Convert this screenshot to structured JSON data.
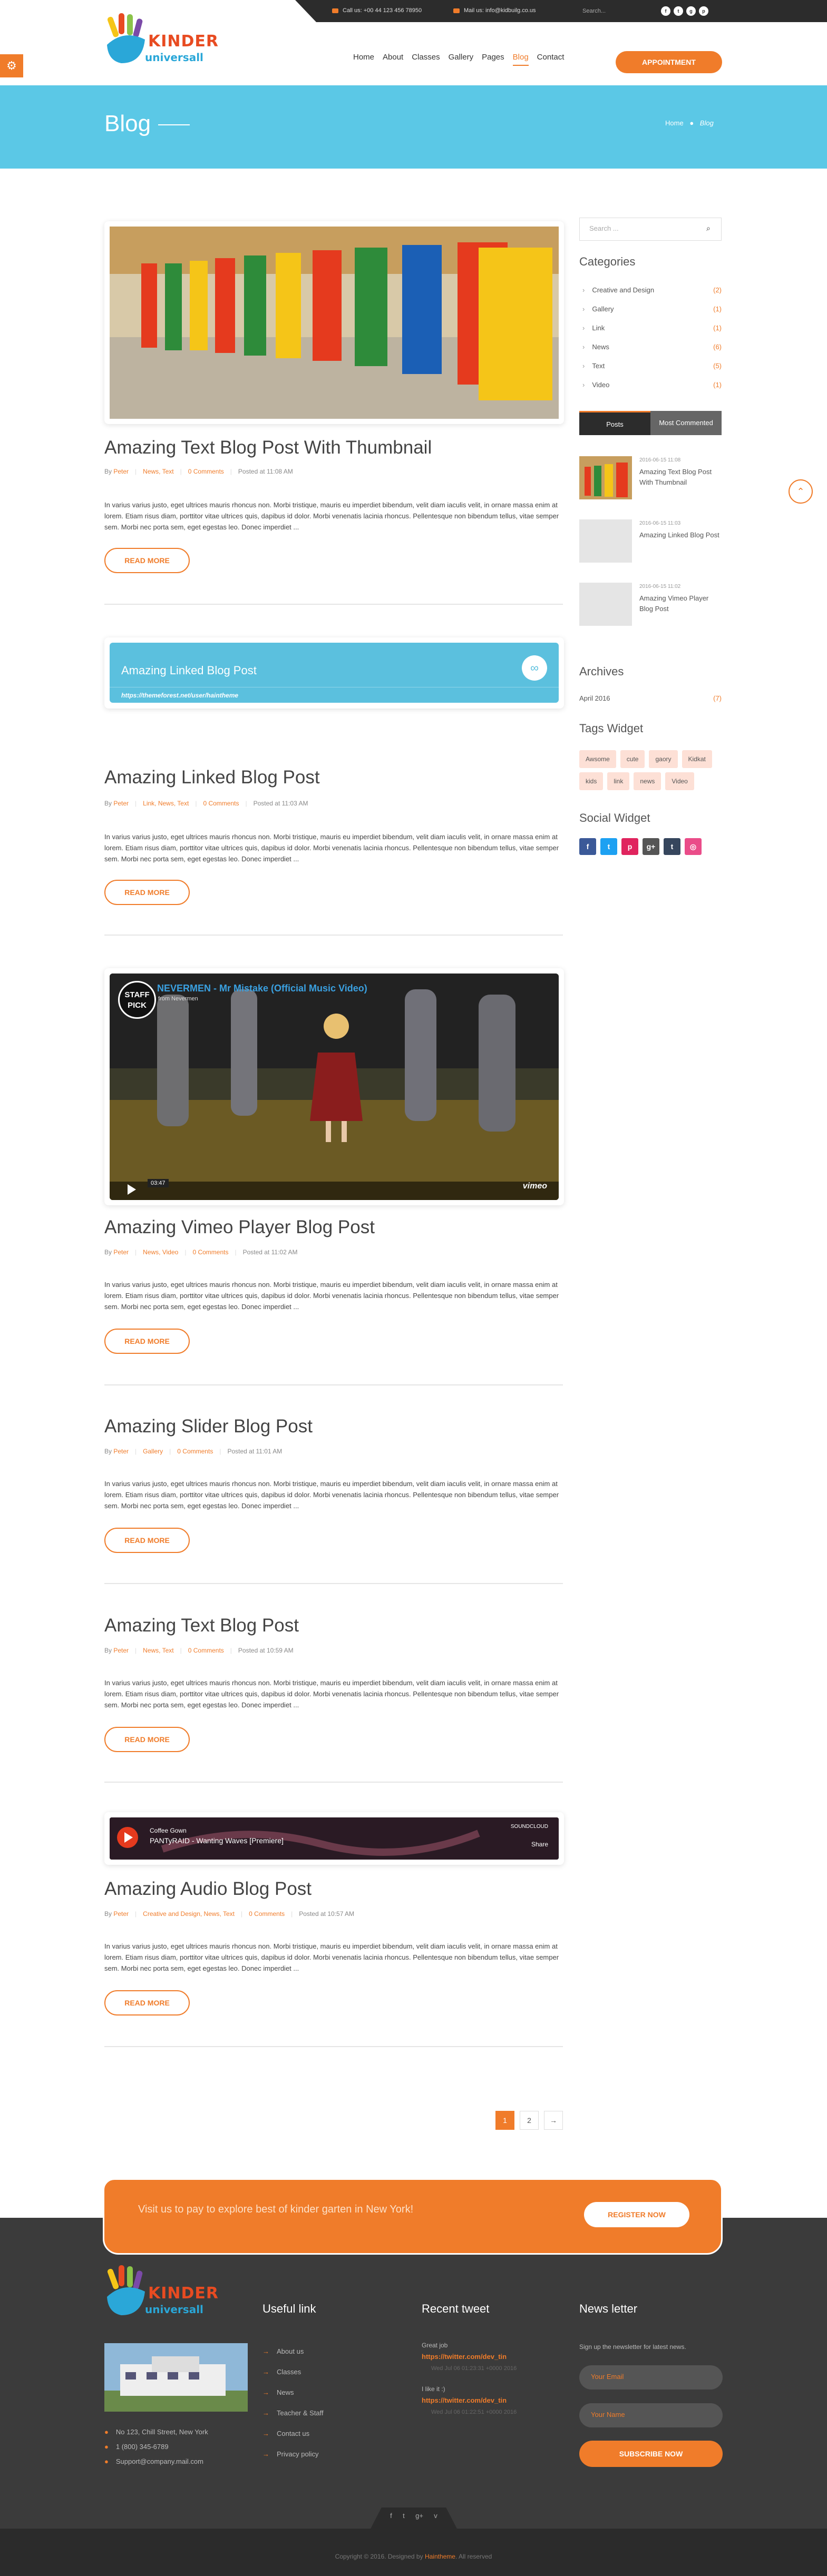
{
  "topbar": {
    "call": "Call us: +00 44 123 456 78950",
    "mail": "Mail us: info@kidbuilg.co.us",
    "search_placeholder": "Search...",
    "social": [
      "f",
      "t",
      "g",
      "p"
    ]
  },
  "logo": {
    "line1": "KINDER",
    "line2": "universall"
  },
  "nav": {
    "items": [
      "Home",
      "About",
      "Classes",
      "Gallery",
      "Pages",
      "Blog",
      "Contact"
    ],
    "appointment": "APPOINTMENT",
    "gear": "⚙"
  },
  "banner": {
    "title": "Blog",
    "breadcrumb_home": "Home",
    "breadcrumb_current": "Blog"
  },
  "posts": [
    {
      "title": "Amazing Text Blog Post With Thumbnail",
      "author": "Peter",
      "cats": "News, Text",
      "comments": "0 Comments",
      "posted": "Posted at 11:08 AM",
      "excerpt": "In varius varius justo, eget ultrices mauris rhoncus non. Morbi tristique, mauris eu imperdiet bibendum, velit diam iaculis velit, in ornare massa enim at lorem. Etiam risus diam, porttitor vitae ultrices quis, dapibus id dolor. Morbi venenatis lacinia rhoncus. Pellentesque non bibendum tellus, vitae semper sem. Morbi nec porta sem, eget egestas leo. Donec imperdiet ...",
      "read": "READ MORE"
    },
    {
      "title": "Amazing Linked Blog Post",
      "author": "Peter",
      "cats": "Link, News, Text",
      "comments": "0 Comments",
      "posted": "Posted at 11:03 AM",
      "excerpt": "In varius varius justo, eget ultrices mauris rhoncus non. Morbi tristique, mauris eu imperdiet bibendum, velit diam iaculis velit, in ornare massa enim at lorem. Etiam risus diam, porttitor vitae ultrices quis, dapibus id dolor. Morbi venenatis lacinia rhoncus. Pellentesque non bibendum tellus, vitae semper sem. Morbi nec porta sem, eget egestas leo. Donec imperdiet ...",
      "read": "READ MORE"
    },
    {
      "title": "Amazing Vimeo Player Blog Post",
      "author": "Peter",
      "cats": "News, Video",
      "comments": "0 Comments",
      "posted": "Posted at 11:02 AM",
      "excerpt": "In varius varius justo, eget ultrices mauris rhoncus non. Morbi tristique, mauris eu imperdiet bibendum, velit diam iaculis velit, in ornare massa enim at lorem. Etiam risus diam, porttitor vitae ultrices quis, dapibus id dolor. Morbi venenatis lacinia rhoncus. Pellentesque non bibendum tellus, vitae semper sem. Morbi nec porta sem, eget egestas leo. Donec imperdiet ...",
      "read": "READ MORE"
    },
    {
      "title": "Amazing Slider Blog Post",
      "author": "Peter",
      "cats": "Gallery",
      "comments": "0 Comments",
      "posted": "Posted at 11:01 AM",
      "excerpt": "In varius varius justo, eget ultrices mauris rhoncus non. Morbi tristique, mauris eu imperdiet bibendum, velit diam iaculis velit, in ornare massa enim at lorem. Etiam risus diam, porttitor vitae ultrices quis, dapibus id dolor. Morbi venenatis lacinia rhoncus. Pellentesque non bibendum tellus, vitae semper sem. Morbi nec porta sem, eget egestas leo. Donec imperdiet ...",
      "read": "READ MORE"
    },
    {
      "title": "Amazing Text Blog Post",
      "author": "Peter",
      "cats": "News, Text",
      "comments": "0 Comments",
      "posted": "Posted at 10:59 AM",
      "excerpt": "In varius varius justo, eget ultrices mauris rhoncus non. Morbi tristique, mauris eu imperdiet bibendum, velit diam iaculis velit, in ornare massa enim at lorem. Etiam risus diam, porttitor vitae ultrices quis, dapibus id dolor. Morbi venenatis lacinia rhoncus. Pellentesque non bibendum tellus, vitae semper sem. Morbi nec porta sem, eget egestas leo. Donec imperdiet ...",
      "read": "READ MORE"
    },
    {
      "title": "Amazing Audio Blog Post",
      "author": "Peter",
      "cats": "Creative and Design, News, Text",
      "comments": "0 Comments",
      "posted": "Posted at 10:57 AM",
      "excerpt": "In varius varius justo, eget ultrices mauris rhoncus non. Morbi tristique, mauris eu imperdiet bibendum, velit diam iaculis velit, in ornare massa enim at lorem. Etiam risus diam, porttitor vitae ultrices quis, dapibus id dolor. Morbi venenatis lacinia rhoncus. Pellentesque non bibendum tellus, vitae semper sem. Morbi nec porta sem, eget egestas leo. Donec imperdiet ...",
      "read": "READ MORE"
    }
  ],
  "linked": {
    "title": "Amazing Linked Blog Post",
    "url": "https://themeforest.net/user/haintheme"
  },
  "video": {
    "title": "NEVERMEN - Mr Mistake (Official Music Video)",
    "by": "from Nevermen",
    "badge": "STAFF PICK",
    "time": "03:47",
    "brand": "vimeo"
  },
  "audio": {
    "label": "SOUNDCLOUD",
    "artist": "Coffee Gown",
    "track": "PANTyRAID - Wanting Waves [Premiere]",
    "share": "Share"
  },
  "sidebar": {
    "search_placeholder": "Search ...",
    "categories_title": "Categories",
    "categories": [
      {
        "name": "Creative and Design",
        "count": "(2)"
      },
      {
        "name": "Gallery",
        "count": "(1)"
      },
      {
        "name": "Link",
        "count": "(1)"
      },
      {
        "name": "News",
        "count": "(6)"
      },
      {
        "name": "Text",
        "count": "(5)"
      },
      {
        "name": "Video",
        "count": "(1)"
      }
    ],
    "tab_posts": "Posts",
    "tab_commented": "Most Commented",
    "recent": [
      {
        "date": "2016-06-15 11:08",
        "title": "Amazing Text Blog Post With Thumbnail"
      },
      {
        "date": "2016-06-15 11:03",
        "title": "Amazing Linked Blog Post"
      },
      {
        "date": "2016-06-15 11:02",
        "title": "Amazing Vimeo Player Blog Post"
      }
    ],
    "archives_title": "Archives",
    "archive_month": "April 2016",
    "archive_count": "(7)",
    "tags_title": "Tags Widget",
    "tags": [
      "Awsome",
      "cute",
      "gaory",
      "Kidkat",
      "kids",
      "link",
      "news",
      "Video"
    ],
    "social_title": "Social Widget",
    "social": [
      "f",
      "t",
      "p",
      "g+",
      "t",
      "◎"
    ]
  },
  "pagination": [
    "1",
    "2",
    "→"
  ],
  "cta": {
    "text": "Visit us to pay to explore best of kinder garten in New York!",
    "button": "REGISTER NOW"
  },
  "footer": {
    "address": "No 123, Chill Street, New York",
    "phone": "1 (800) 345-6789",
    "email": "Support@company.mail.com",
    "useful_title": "Useful link",
    "useful": [
      "About us",
      "Classes",
      "News",
      "Teacher & Staff",
      "Contact us",
      "Privacy policy"
    ],
    "tweet_title": "Recent tweet",
    "tweets": [
      {
        "text": "Great job",
        "link": "https://twitter.com/dev_tin",
        "date": "Wed Jul 06 01:23:31 +0000 2016"
      },
      {
        "text": "I like it :)",
        "link": "https://twitter.com/dev_tin",
        "date": "Wed Jul 06 01:22:51 +0000 2016"
      }
    ],
    "news_title": "News letter",
    "news_text": "Sign up the newsletter for latest news.",
    "email_placeholder": "Your Email",
    "name_placeholder": "Your Name",
    "subscribe": "SUBSCRIBE NOW",
    "social": [
      "f",
      "t",
      "g+",
      "v"
    ],
    "copyright_pre": "Copyright © 2016. Designed by",
    "copyright_brand": "Haintheme",
    "copyright_post": ". All reserved"
  },
  "colors": {
    "accent": "#f07c2a",
    "banner": "#5bc8e6",
    "dark": "#3b3b3b"
  }
}
